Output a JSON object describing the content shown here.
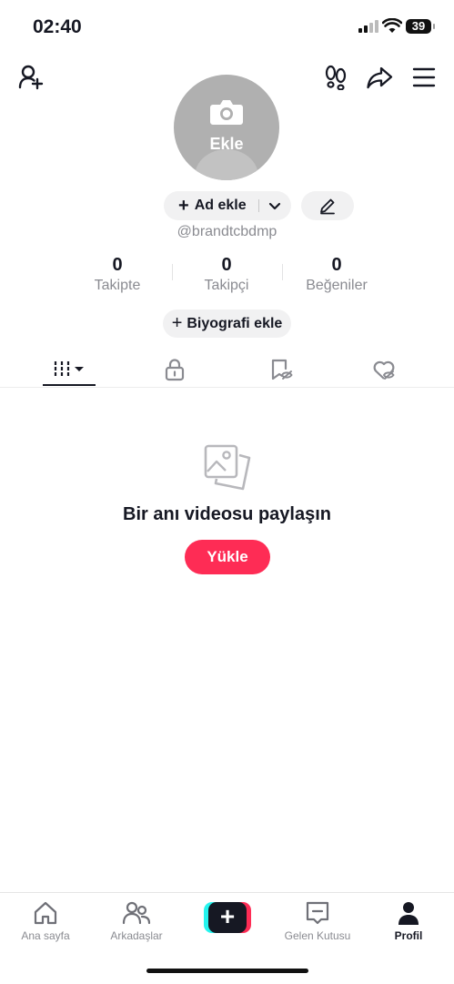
{
  "status_bar": {
    "time": "02:40",
    "battery": "39"
  },
  "profile": {
    "avatar_label": "Ekle",
    "add_name_label": "Ad ekle",
    "username": "@brandtcbdmp",
    "bio_label": "Biyografi ekle"
  },
  "stats": [
    {
      "value": "0",
      "label": "Takipte"
    },
    {
      "value": "0",
      "label": "Takipçi"
    },
    {
      "value": "0",
      "label": "Beğeniler"
    }
  ],
  "empty_state": {
    "title": "Bir anı videosu paylaşın",
    "button": "Yükle"
  },
  "bottom_nav": {
    "home": "Ana sayfa",
    "friends": "Arkadaşlar",
    "inbox": "Gelen Kutusu",
    "profile": "Profil"
  },
  "colors": {
    "accent": "#fe2c55",
    "text": "#161823",
    "muted": "#8a8b91",
    "cyan": "#25f4ee"
  }
}
